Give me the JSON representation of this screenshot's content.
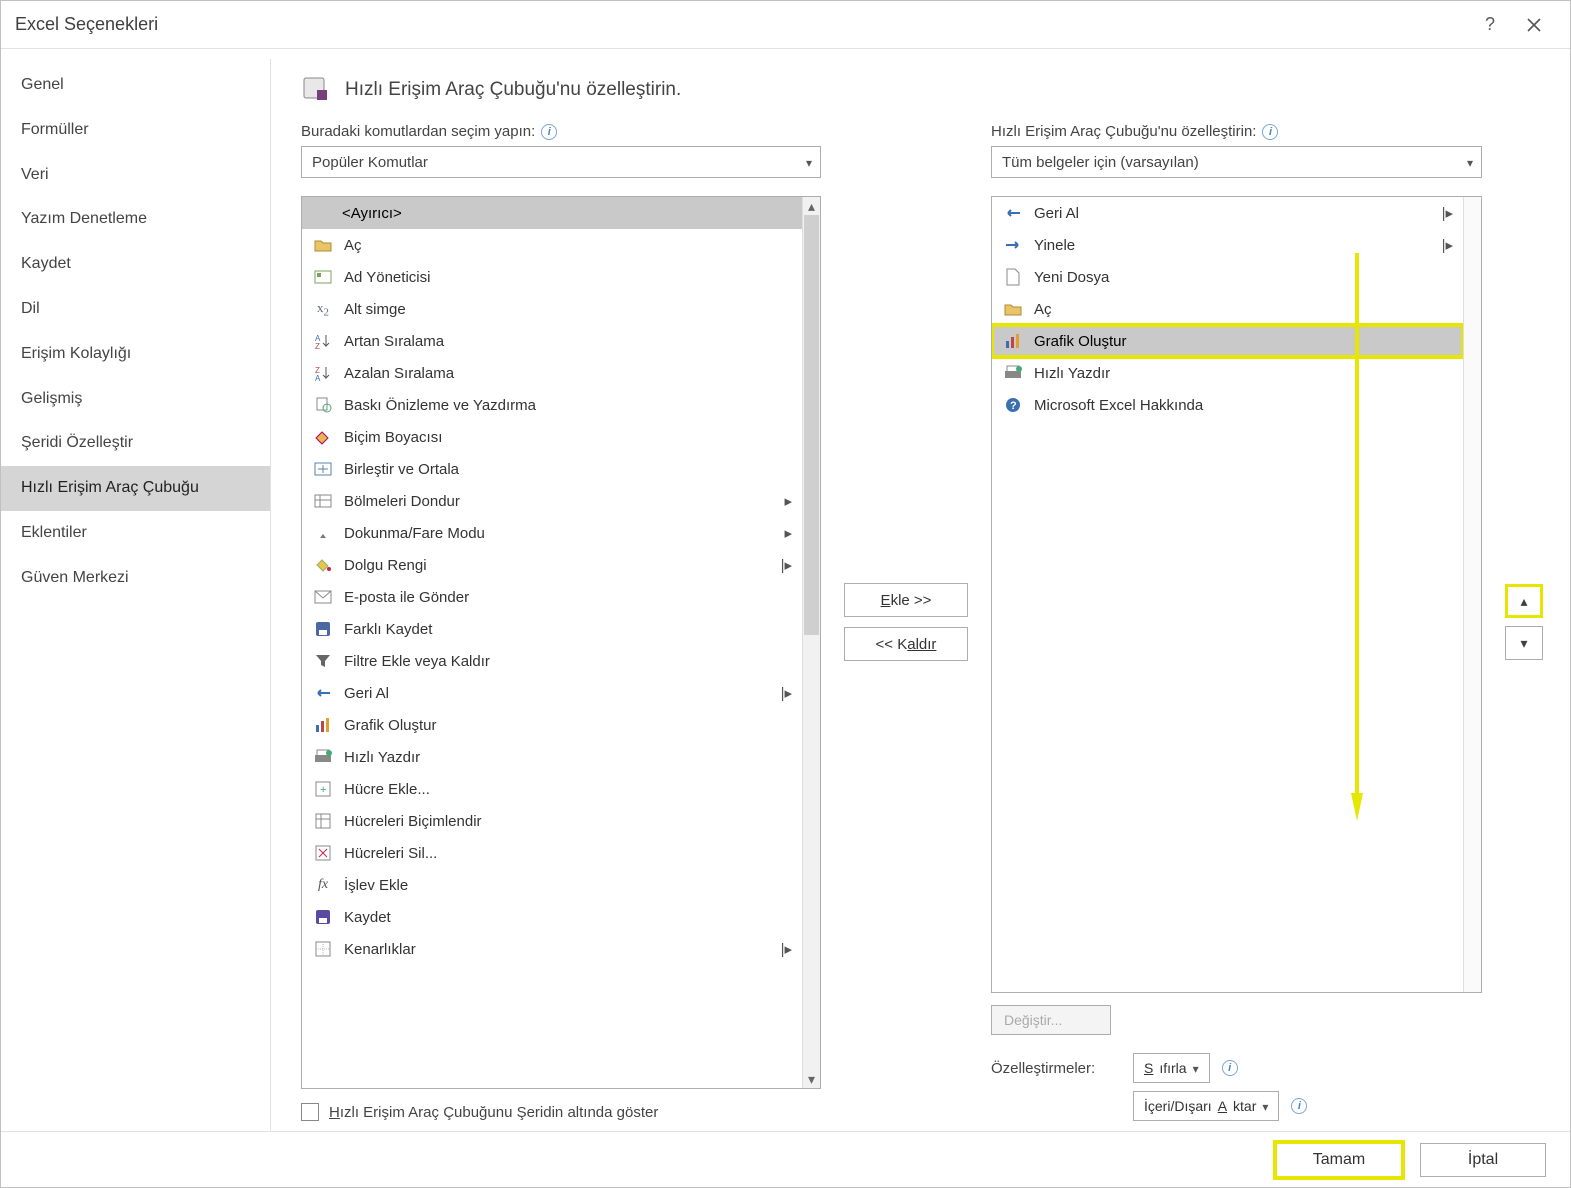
{
  "title": "Excel Seçenekleri",
  "sidebar": {
    "items": [
      {
        "label": "Genel"
      },
      {
        "label": "Formüller"
      },
      {
        "label": "Veri"
      },
      {
        "label": "Yazım Denetleme"
      },
      {
        "label": "Kaydet"
      },
      {
        "label": "Dil"
      },
      {
        "label": "Erişim Kolaylığı"
      },
      {
        "label": "Gelişmiş"
      },
      {
        "label": "Şeridi Özelleştir"
      },
      {
        "label": "Hızlı Erişim Araç Çubuğu"
      },
      {
        "label": "Eklentiler"
      },
      {
        "label": "Güven Merkezi"
      }
    ],
    "selected_index": 9
  },
  "header": {
    "label": "Hızlı Erişim Araç Çubuğu'nu özelleştirin."
  },
  "left": {
    "source_label": "Buradaki komutlardan seçim yapın:",
    "source_combo": "Popüler Komutlar",
    "commands": [
      {
        "icon": "separator",
        "label": "<Ayırıcı>",
        "selected": true
      },
      {
        "icon": "folder",
        "label": "Aç"
      },
      {
        "icon": "id",
        "label": "Ad Yöneticisi"
      },
      {
        "icon": "subscript",
        "label": "Alt simge"
      },
      {
        "icon": "sort-asc",
        "label": "Artan Sıralama"
      },
      {
        "icon": "sort-desc",
        "label": "Azalan Sıralama"
      },
      {
        "icon": "print-preview",
        "label": "Baskı Önizleme ve Yazdırma"
      },
      {
        "icon": "paint",
        "label": "Biçim Boyacısı"
      },
      {
        "icon": "merge",
        "label": "Birleştir ve Ortala"
      },
      {
        "icon": "freeze",
        "label": "Bölmeleri Dondur",
        "submenu": true
      },
      {
        "icon": "touch",
        "label": "Dokunma/Fare Modu",
        "submenu": true
      },
      {
        "icon": "fill",
        "label": "Dolgu Rengi",
        "split": true
      },
      {
        "icon": "mail",
        "label": "E-posta ile Gönder"
      },
      {
        "icon": "saveas",
        "label": "Farklı Kaydet"
      },
      {
        "icon": "filter",
        "label": "Filtre Ekle veya Kaldır"
      },
      {
        "icon": "undo",
        "label": "Geri Al",
        "split": true
      },
      {
        "icon": "chart",
        "label": "Grafik Oluştur"
      },
      {
        "icon": "quickprint",
        "label": "Hızlı Yazdır"
      },
      {
        "icon": "insertcell",
        "label": "Hücre Ekle..."
      },
      {
        "icon": "formatcell",
        "label": "Hücreleri Biçimlendir"
      },
      {
        "icon": "deletecell",
        "label": "Hücreleri Sil..."
      },
      {
        "icon": "fx",
        "label": "İşlev Ekle"
      },
      {
        "icon": "save",
        "label": "Kaydet"
      },
      {
        "icon": "border",
        "label": "Kenarlıklar",
        "split": true
      }
    ],
    "showbelow_label": "Hızlı Erişim Araç Çubuğunu Şeridin altında göster"
  },
  "mid": {
    "add_label_pre": "E",
    "add_label": "kle >>",
    "remove_label_pre": "<< K",
    "remove_label": "aldır"
  },
  "right": {
    "target_label": "Hızlı Erişim Araç Çubuğu'nu özelleştirin:",
    "target_combo": "Tüm belgeler için (varsayılan)",
    "commands": [
      {
        "icon": "undo",
        "label": "Geri Al",
        "split": true
      },
      {
        "icon": "redo",
        "label": "Yinele",
        "split": true
      },
      {
        "icon": "newfile",
        "label": "Yeni Dosya"
      },
      {
        "icon": "folder",
        "label": "Aç"
      },
      {
        "icon": "chart",
        "label": "Grafik Oluştur",
        "selected": true,
        "highlight": true
      },
      {
        "icon": "quickprint",
        "label": "Hızlı Yazdır"
      },
      {
        "icon": "about",
        "label": "Microsoft Excel Hakkında"
      }
    ],
    "modify_label": "Değiştir...",
    "custom_label": "Özelleştirmeler:",
    "reset_btn_pre": "S",
    "reset_btn": "ıfırla",
    "import_btn_pre": "İçeri/Dışarı ",
    "import_btn_under": "A",
    "import_btn_post": "ktar"
  },
  "footer": {
    "ok": "Tamam",
    "cancel": "İptal"
  }
}
